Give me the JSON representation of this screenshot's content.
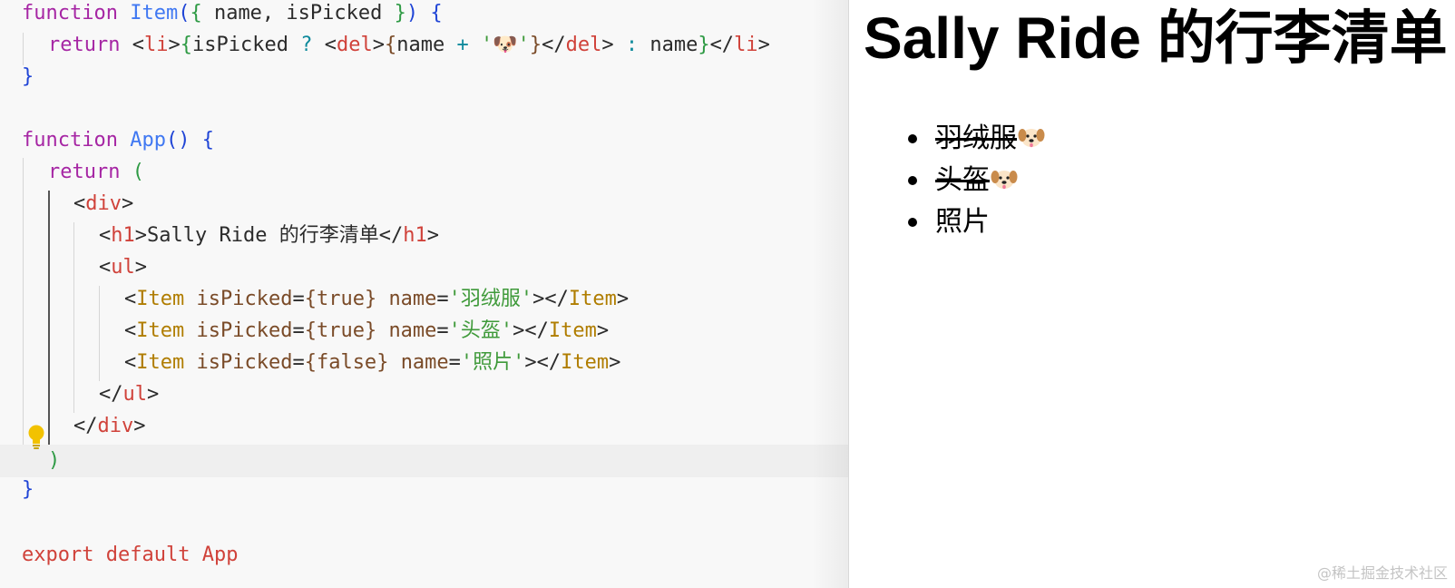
{
  "editor": {
    "code": {
      "item_sig_kw": "function",
      "item_sig_name": "Item",
      "item_sig_rest": " name, isPicked ",
      "item_return_kw": "return",
      "item_ret_li_open": "li",
      "item_ret_cond": "isPicked",
      "item_ret_q": "?",
      "item_ret_del_open": "del",
      "item_ret_name": "name",
      "item_ret_plus": "+",
      "item_ret_str": "'🐶'",
      "item_ret_del_close": "del",
      "item_ret_colon": ":",
      "item_ret_name2": "name",
      "item_ret_li_close": "li",
      "app_sig_kw": "function",
      "app_sig_name": "App",
      "app_return_kw": "return",
      "div_open": "div",
      "h1_open": "h1",
      "h1_text": "Sally Ride 的行李清单",
      "h1_close": "h1",
      "ul_open": "ul",
      "items": [
        {
          "comp": "Item",
          "attr": "isPicked",
          "value": "true",
          "name_attr": "name",
          "name": "'羽绒服'"
        },
        {
          "comp": "Item",
          "attr": "isPicked",
          "value": "true",
          "name_attr": "name",
          "name": "'头盔'"
        },
        {
          "comp": "Item",
          "attr": "isPicked",
          "value": "false",
          "name_attr": "name",
          "name": "'照片'"
        }
      ],
      "ul_close": "ul",
      "div_close": "div",
      "export_kw": "export",
      "default_kw": "default",
      "export_name": "App"
    },
    "lightbulb_icon": "lightbulb-icon"
  },
  "preview": {
    "title": "Sally Ride 的行李清单",
    "items": [
      {
        "label": "羽绒服",
        "picked": true
      },
      {
        "label": "头盔",
        "picked": true
      },
      {
        "label": "照片",
        "picked": false
      }
    ],
    "picked_icon": "dog-face-icon"
  },
  "watermark": "@稀土掘金技术社区",
  "colors": {
    "keyword": "#a626a4",
    "function_name": "#4078f2",
    "tag": "#d0423a",
    "component": "#b07d00",
    "string": "#3f9a3a",
    "bulb": "#f2c200"
  }
}
